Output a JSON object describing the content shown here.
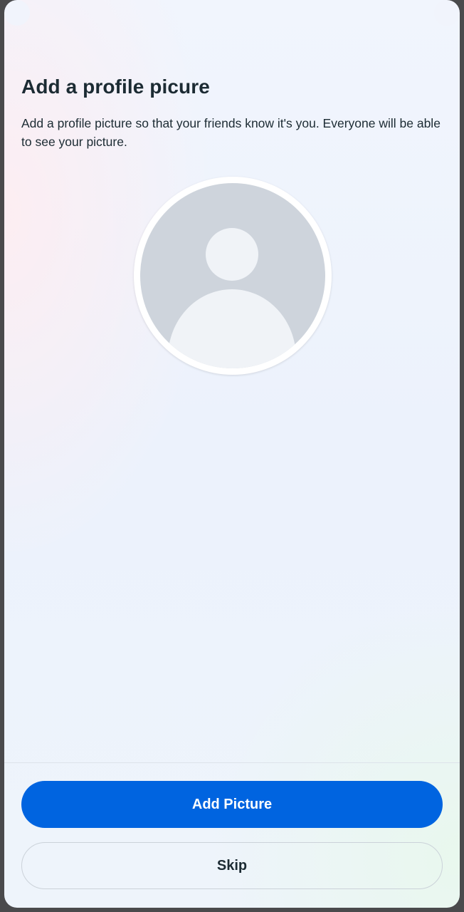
{
  "screen": {
    "title": "Add a profile picure",
    "description": "Add a profile picture so that your friends know it's you. Everyone will be able to see your picture."
  },
  "avatar": {
    "icon": "person-placeholder-icon",
    "background_color": "#ced4dc",
    "figure_color": "#f0f3f7"
  },
  "actions": {
    "primary_label": "Add Picture",
    "secondary_label": "Skip",
    "primary_color": "#0064e0"
  }
}
